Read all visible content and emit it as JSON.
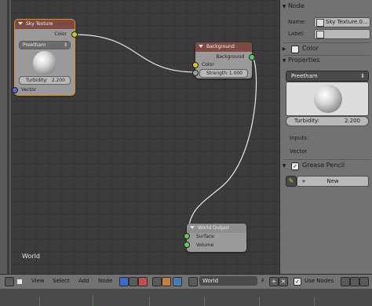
{
  "editor": {
    "world_label": "World"
  },
  "nodes": {
    "sky_texture": {
      "title": "Sky Texture",
      "output": "Color",
      "dropdown": "Preetham",
      "turbidity_label": "Turbidity:",
      "turbidity_value": "2.200",
      "input": "Vector"
    },
    "background": {
      "title": "Background",
      "output": "Background",
      "input_color": "Color",
      "strength_label": "Strength:",
      "strength_value": "1.000"
    },
    "world_output": {
      "title": "World Output",
      "input_surface": "Surface",
      "input_volume": "Volume"
    }
  },
  "sidebar": {
    "node_section": "Node",
    "name_label": "Name:",
    "name_value": "Sky Texture.0...",
    "label_label": "Label:",
    "color_section": "Color",
    "properties_section": "Properties",
    "model_dropdown": "Preetham",
    "turbidity_label": "Turbidity:",
    "turbidity_value": "2.200",
    "inputs_label": "Inputs:",
    "vector_label": "Vector",
    "grease_pencil_section": "Grease Pencil",
    "new_button": "New"
  },
  "header": {
    "menu_view": "View",
    "menu_select": "Select",
    "menu_add": "Add",
    "menu_node": "Node",
    "world_field": "World",
    "fake_user": "F",
    "use_nodes_label": "Use Nodes"
  },
  "colors": {
    "socket_color": "#c8c829",
    "socket_shader": "#62c862",
    "socket_vector": "#6464c8",
    "socket_float": "#a1a1a1",
    "node_header": "#7e4a44",
    "selection": "#e88a1c"
  },
  "icons": [
    "shader-node-icon",
    "world-icon",
    "texture-icon",
    "render-icon",
    "link-icon",
    "pin-icon",
    "close-icon",
    "add-icon",
    "color-swatch-icon",
    "pencil-icon"
  ]
}
